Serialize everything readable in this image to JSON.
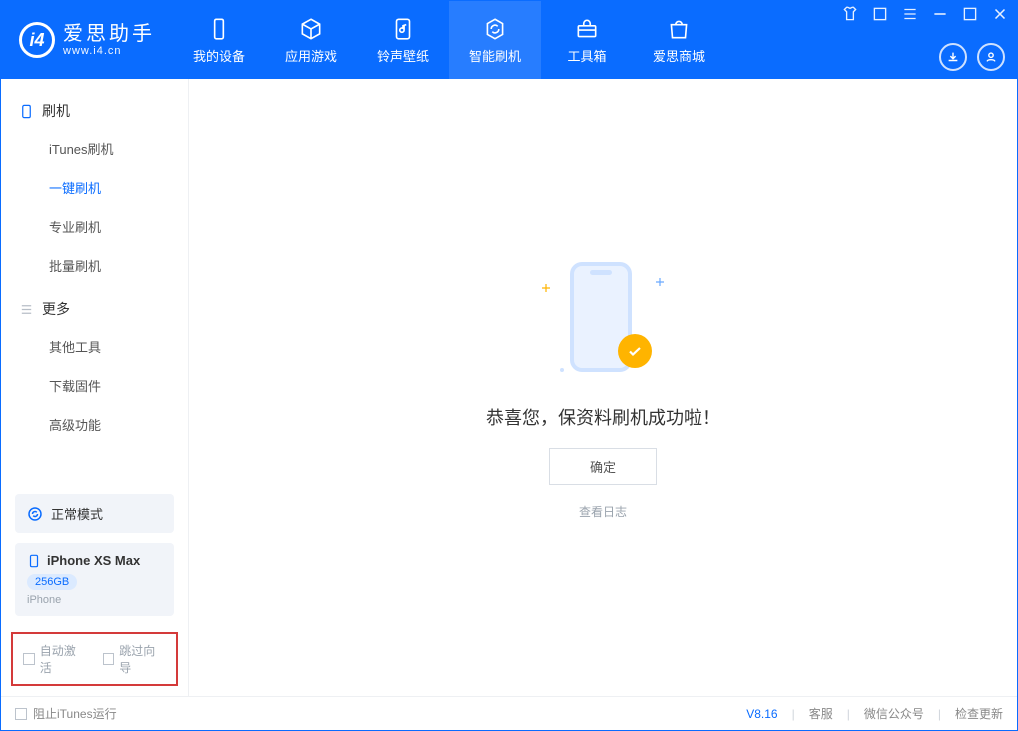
{
  "app": {
    "name": "爱思助手",
    "url": "www.i4.cn"
  },
  "nav": [
    "我的设备",
    "应用游戏",
    "铃声壁纸",
    "智能刷机",
    "工具箱",
    "爱思商城"
  ],
  "nav_active": 3,
  "sidebar": {
    "group1": {
      "title": "刷机",
      "items": [
        "iTunes刷机",
        "一键刷机",
        "专业刷机",
        "批量刷机"
      ],
      "active": 1
    },
    "group2": {
      "title": "更多",
      "items": [
        "其他工具",
        "下载固件",
        "高级功能"
      ]
    },
    "mode": "正常模式",
    "device": {
      "name": "iPhone XS Max",
      "capacity": "256GB",
      "kind": "iPhone"
    },
    "checks": {
      "auto_activate": "自动激活",
      "skip_guide": "跳过向导"
    }
  },
  "main": {
    "success": "恭喜您，保资料刷机成功啦！",
    "ok": "确定",
    "log": "查看日志"
  },
  "status": {
    "block_itunes": "阻止iTunes运行",
    "version": "V8.16",
    "links": [
      "客服",
      "微信公众号",
      "检查更新"
    ]
  }
}
